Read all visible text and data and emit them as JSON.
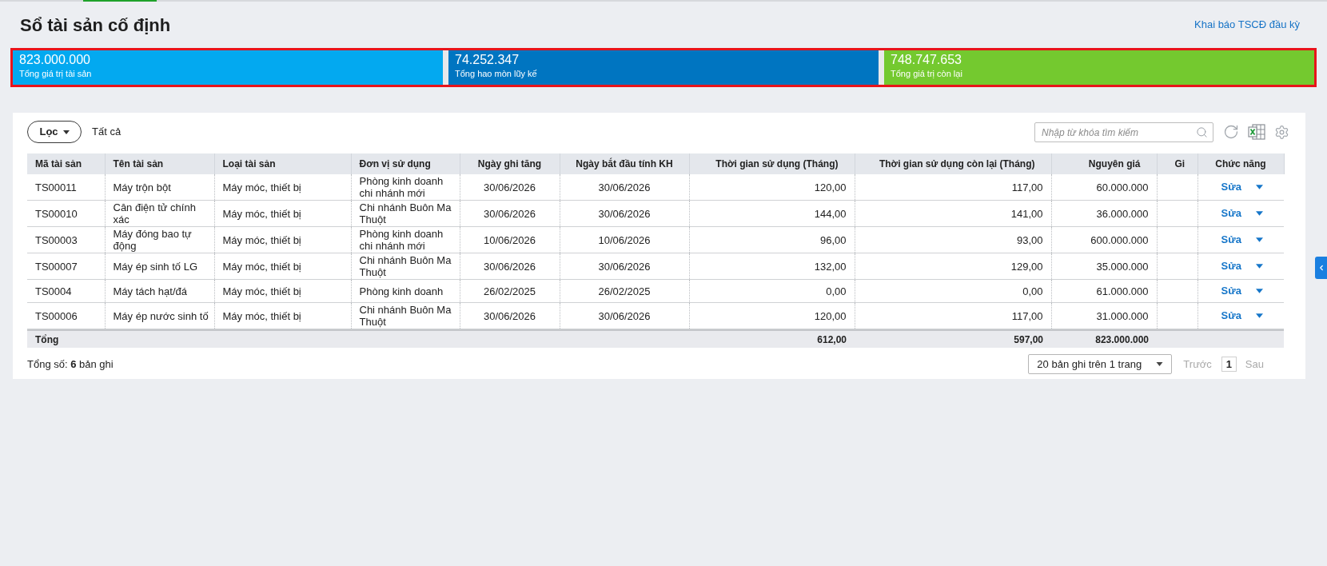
{
  "page": {
    "title": "Sổ tài sản cố định",
    "link": "Khai báo TSCĐ đầu kỳ"
  },
  "summary": [
    {
      "value": "823.000.000",
      "label": "Tổng giá trị tài sản",
      "color": "#03a9f0"
    },
    {
      "value": "74.252.347",
      "label": "Tổng hao mòn lũy kế",
      "color": "#0075c1"
    },
    {
      "value": "748.747.653",
      "label": "Tổng giá trị còn lại",
      "color": "#74c92f"
    }
  ],
  "toolbar": {
    "filter": {
      "label": "Lọc",
      "value": "Tất cả"
    },
    "search": {
      "placeholder": "Nhập từ khóa tìm kiếm"
    }
  },
  "table": {
    "columns": [
      {
        "label": "Mã tài sản"
      },
      {
        "label": "Tên tài sản"
      },
      {
        "label": "Loại tài sản"
      },
      {
        "label": "Đơn vị sử dụng"
      },
      {
        "label": "Ngày ghi tăng"
      },
      {
        "label": "Ngày bắt đầu tính KH"
      },
      {
        "label": "Thời gian sử dụng (Tháng)",
        "total": "612,00"
      },
      {
        "label": "Thời gian sử dụng còn lại (Tháng)",
        "total": "597,00"
      },
      {
        "label": "Nguyên giá",
        "total": "823.000.000"
      },
      {
        "label": "Gi"
      },
      {
        "label": "Chức năng"
      }
    ],
    "rows": [
      {
        "cells": [
          "TS00011",
          "Máy trộn bột",
          "Máy móc, thiết bị",
          "Phòng kinh doanh chi nhánh mới",
          "30/06/2026",
          "30/06/2026",
          "120,00",
          "117,00",
          "60.000.000"
        ],
        "action": "Sửa"
      },
      {
        "cells": [
          "TS00010",
          "Cân điện tử chính xác",
          "Máy móc, thiết bị",
          "Chi nhánh Buôn Ma Thuột",
          "30/06/2026",
          "30/06/2026",
          "144,00",
          "141,00",
          "36.000.000"
        ],
        "action": "Sửa"
      },
      {
        "cells": [
          "TS00003",
          "Máy đóng bao tự động",
          "Máy móc, thiết bị",
          "Phòng kinh doanh chi nhánh mới",
          "10/06/2026",
          "10/06/2026",
          "96,00",
          "93,00",
          "600.000.000"
        ],
        "action": "Sửa"
      },
      {
        "cells": [
          "TS00007",
          "Máy ép sinh tố LG",
          "Máy móc, thiết bị",
          "Chi nhánh Buôn Ma Thuột",
          "30/06/2026",
          "30/06/2026",
          "132,00",
          "129,00",
          "35.000.000"
        ],
        "action": "Sửa"
      },
      {
        "cells": [
          "TS0004",
          "Máy tách hạt/đá",
          "Máy móc, thiết bị",
          "Phòng kinh doanh",
          "26/02/2025",
          "26/02/2025",
          "0,00",
          "0,00",
          "61.000.000"
        ],
        "action": "Sửa"
      },
      {
        "cells": [
          "TS00006",
          "Máy ép nước sinh tố",
          "Máy móc, thiết bị",
          "Chi nhánh Buôn Ma Thuột",
          "30/06/2026",
          "30/06/2026",
          "120,00",
          "117,00",
          "31.000.000"
        ],
        "action": "Sửa"
      }
    ],
    "total_label": "Tổng"
  },
  "pagination": {
    "summary": "Tổng số: **6** bản ghi",
    "page_size": "20 bản ghi trên 1 trang",
    "previous": {
      "label": "Trước",
      "disabled": true
    },
    "pages": [
      {
        "label": "1",
        "selected": true
      }
    ],
    "next": {
      "label": "Sau",
      "disabled": true
    }
  }
}
